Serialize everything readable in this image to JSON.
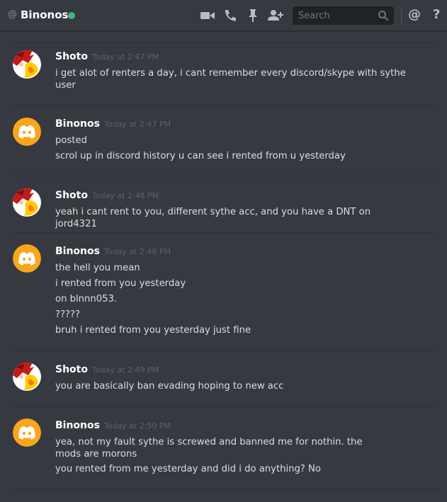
{
  "header": {
    "at_symbol": "@",
    "channel_name": "Binonos",
    "status_color": "#43b581",
    "icons": [
      "video-icon",
      "phone-icon",
      "pin-icon",
      "add-user-icon",
      "search-icon",
      "mention-icon",
      "help-icon"
    ]
  },
  "search": {
    "placeholder": "Search"
  },
  "toolbar": {
    "mention": "@",
    "help": "?"
  },
  "messages": [
    {
      "author": "Shoto",
      "avatar": "shoto-avatar",
      "timestamp": "Today at 2:47 PM",
      "lines": [
        "i get alot of renters a day, i cant remember every discord/skype with sythe user"
      ]
    },
    {
      "author": "Binonos",
      "avatar": "discord-default-avatar",
      "timestamp": "Today at 2:47 PM",
      "lines": [
        "posted",
        "scrol up in discord history u can see i rented from u yesterday"
      ]
    },
    {
      "author": "Shoto",
      "avatar": "shoto-avatar",
      "timestamp": "Today at 2:48 PM",
      "lines": [
        "yeah i cant rent to you, different sythe acc, and you have a DNT on jord4321"
      ]
    },
    {
      "author": "Binonos",
      "avatar": "discord-default-avatar",
      "timestamp": "Today at 2:48 PM",
      "lines": [
        "the hell you mean",
        "i rented from you yesterday",
        "on blnnn053.",
        "?????",
        "bruh i rented from you yesterday just fine"
      ]
    },
    {
      "author": "Shoto",
      "avatar": "shoto-avatar",
      "timestamp": "Today at 2:49 PM",
      "lines": [
        "you are basically ban evading hoping to new acc"
      ]
    },
    {
      "author": "Binonos",
      "avatar": "discord-default-avatar",
      "timestamp": "Today at 2:50 PM",
      "lines": [
        "yea, not my fault sythe is screwed and banned me for nothin. the mods are morons",
        "you rented from me yesterday and did i do anything? No"
      ]
    }
  ],
  "colors": {
    "background": "#36393f",
    "discord_avatar": "#faa61a",
    "username": "#ffffff",
    "timestamp": "#5d6065"
  }
}
